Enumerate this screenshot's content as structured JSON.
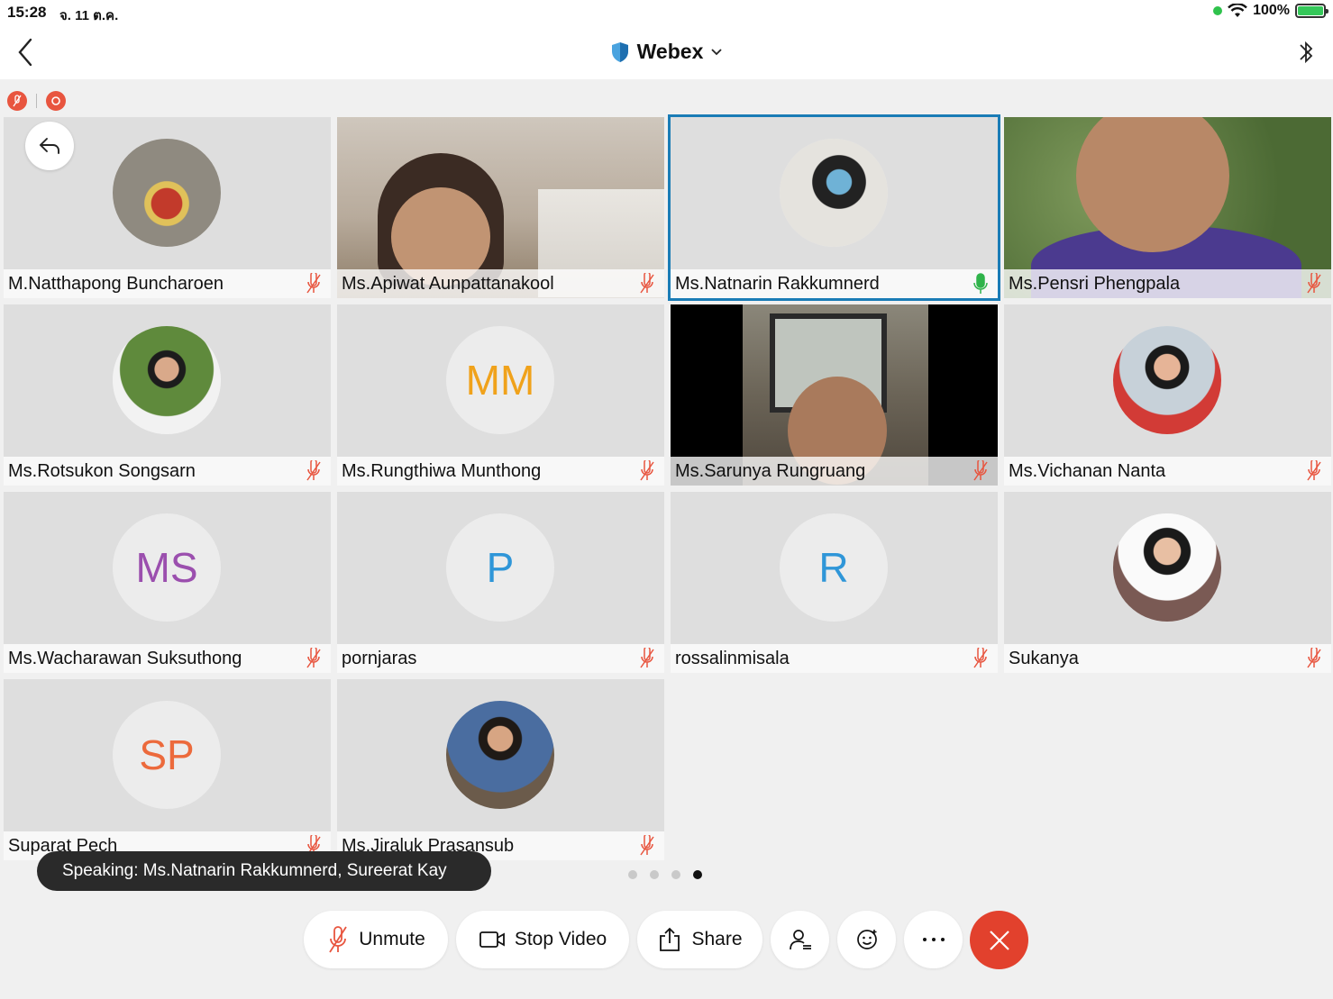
{
  "status_bar": {
    "time": "15:28",
    "date": "จ. 11 ต.ค.",
    "battery": "100%"
  },
  "app": {
    "title": "Webex"
  },
  "participants": [
    {
      "name": "M.Natthapong Buncharoen",
      "avatar_type": "photo",
      "mic": "muted"
    },
    {
      "name": "Ms.Apiwat Aunpattanakool",
      "avatar_type": "video",
      "mic": "muted"
    },
    {
      "name": "Ms.Natnarin Rakkumnerd",
      "avatar_type": "photo",
      "mic": "active",
      "active_speaker": true
    },
    {
      "name": "Ms.Pensri Phengpala",
      "avatar_type": "video",
      "mic": "muted"
    },
    {
      "name": "Ms.Rotsukon Songsarn",
      "avatar_type": "photo",
      "mic": "muted"
    },
    {
      "name": "Ms.Rungthiwa Munthong",
      "avatar_type": "initials",
      "initials": "MM",
      "initials_color": "#f0a21b",
      "mic": "muted"
    },
    {
      "name": "Ms.Sarunya Rungruang",
      "avatar_type": "video",
      "mic": "muted"
    },
    {
      "name": "Ms.Vichanan Nanta",
      "avatar_type": "photo",
      "mic": "muted"
    },
    {
      "name": "Ms.Wacharawan Suksuthong",
      "avatar_type": "initials",
      "initials": "MS",
      "initials_color": "#9b4fae",
      "mic": "muted"
    },
    {
      "name": "pornjaras",
      "avatar_type": "initials",
      "initials": "P",
      "initials_color": "#2f96d8",
      "mic": "muted"
    },
    {
      "name": "rossalinmisala",
      "avatar_type": "initials",
      "initials": "R",
      "initials_color": "#2f96d8",
      "mic": "muted"
    },
    {
      "name": "Sukanya",
      "avatar_type": "photo",
      "mic": "muted"
    },
    {
      "name": "Suparat Pech",
      "avatar_type": "initials",
      "initials": "SP",
      "initials_color": "#ec6a3c",
      "mic": "muted"
    },
    {
      "name": "Ms.Jiraluk Prasansub",
      "avatar_type": "photo",
      "mic": "muted"
    }
  ],
  "speaking_toast": "Speaking: Ms.Natnarin Rakkumnerd, Sureerat Kay",
  "pagination": {
    "pages": 4,
    "current": 4
  },
  "controls": {
    "unmute": "Unmute",
    "stop_video": "Stop Video",
    "share": "Share"
  },
  "colors": {
    "accent": "#1a7cb6",
    "end_call": "#e2412d",
    "muted_mic": "#e8553f",
    "active_mic": "#2fb34a"
  }
}
